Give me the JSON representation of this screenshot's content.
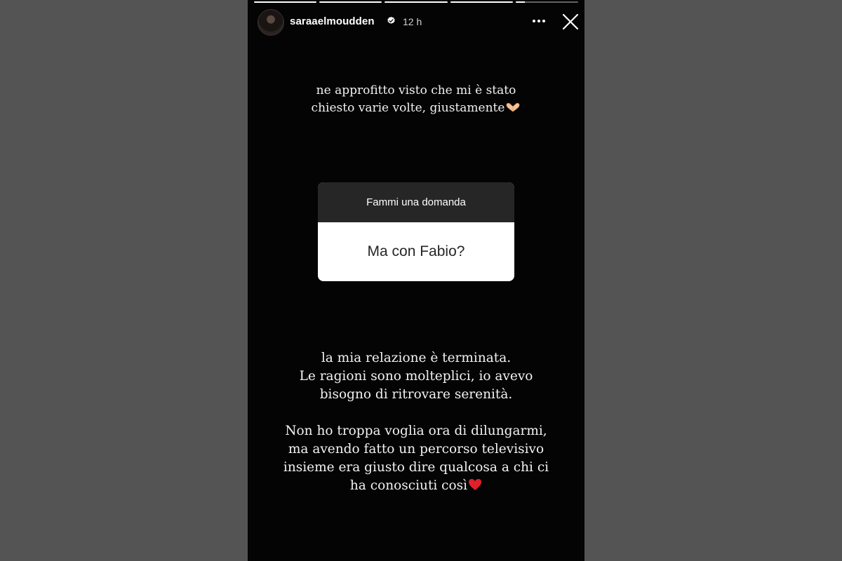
{
  "story": {
    "progress": [
      1,
      1,
      1,
      1,
      0.15
    ],
    "user": {
      "username": "saraaelmoudden",
      "time": "12 h"
    },
    "caption_top": {
      "line1": "ne approfitto visto che mi è stato",
      "line2": "chiesto varie volte, giustamente"
    },
    "question_sticker": {
      "title": "Fammi una domanda",
      "question": "Ma con Fabio?"
    },
    "caption_bottom": {
      "p1": [
        "la mia relazione è terminata.",
        "Le ragioni sono molteplici, io avevo",
        "bisogno di ritrovare serenità."
      ],
      "p2": [
        "Non ho troppa voglia ora di dilungarmi,",
        "ma avendo fatto un percorso televisivo",
        "insieme era giusto dire qualcosa a chi ci",
        "ha conosciuti così"
      ]
    },
    "icons": {
      "verified": "verified-badge-icon",
      "more": "more-horizontal-icon",
      "close": "close-icon",
      "hands": "heart-hands-emoji",
      "heart": "red-heart-emoji"
    },
    "colors": {
      "story_bg": "#040404",
      "page_bg": "#545454",
      "sticker_header": "#262626",
      "heart": "#e0202a"
    }
  }
}
